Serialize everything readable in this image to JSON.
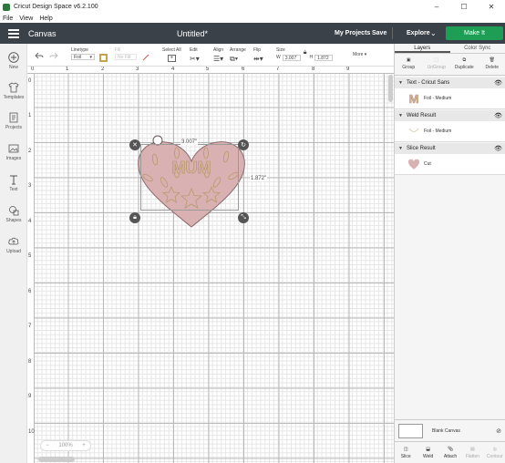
{
  "window": {
    "title": "Cricut Design Space  v6.2.100",
    "minimize": "–",
    "maximize": "☐",
    "close": "✕"
  },
  "menu": [
    "File",
    "View",
    "Help"
  ],
  "header": {
    "section": "Canvas",
    "doc_title": "Untitled*",
    "my_projects": "My Projects",
    "save": "Save",
    "explore": "Explore",
    "make_it": "Make It"
  },
  "sidebar": [
    {
      "label": "New",
      "icon": "plus-icon"
    },
    {
      "label": "Templates",
      "icon": "shirt-icon"
    },
    {
      "label": "Projects",
      "icon": "projects-icon"
    },
    {
      "label": "Images",
      "icon": "image-icon"
    },
    {
      "label": "Text",
      "icon": "text-icon"
    },
    {
      "label": "Shapes",
      "icon": "shapes-icon"
    },
    {
      "label": "Upload",
      "icon": "cloud-upload-icon"
    }
  ],
  "toolbar": {
    "linetype_label": "Linetype",
    "linetype_value": "Foil",
    "fill_label": "Fill",
    "fill_value": "No Fill",
    "select_all": "Select All",
    "edit": "Edit",
    "align": "Align",
    "arrange": "Arrange",
    "flip": "Flip",
    "size": "Size",
    "w_label": "W",
    "w_value": "3.007",
    "h_label": "H",
    "h_value": "1.872",
    "more": "More"
  },
  "ruler": {
    "top": [
      "0",
      "1",
      "2",
      "3",
      "4",
      "5",
      "6",
      "7",
      "8",
      "9"
    ],
    "left": [
      "0",
      "1",
      "2",
      "3",
      "4",
      "5",
      "6",
      "7",
      "8",
      "9",
      "10"
    ]
  },
  "selection": {
    "width_label": "3.007\"",
    "height_label": "1.872\"",
    "design_text": "MUM"
  },
  "zoom": "100%",
  "right_panel": {
    "tabs": [
      "Layers",
      "Color Sync"
    ],
    "actions": [
      "Group",
      "UnGroup",
      "Duplicate",
      "Delete"
    ],
    "groups": [
      {
        "title": "Text - Cricut Sans",
        "item": "Foil - Medium"
      },
      {
        "title": "Weld Result",
        "item": "Foil - Medium"
      },
      {
        "title": "Slice Result",
        "item": "Cut"
      }
    ],
    "blank_canvas": "Blank Canvas",
    "bottom_actions": [
      "Slice",
      "Weld",
      "Attach",
      "Flatten",
      "Contour"
    ]
  },
  "colors": {
    "header": "#3b4148",
    "make_it": "#1e9e55",
    "heart": "#d9b1b3",
    "foil": "#c9a24d"
  }
}
